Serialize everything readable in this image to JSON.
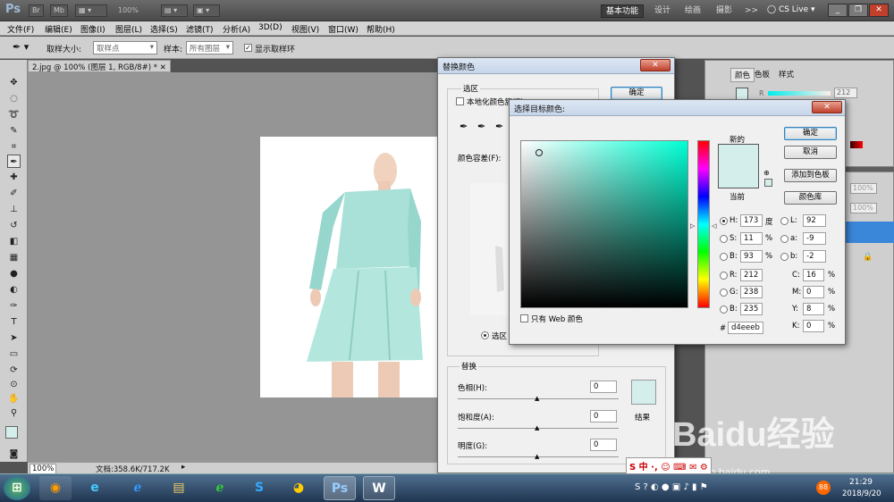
{
  "app": {
    "logo": "Ps",
    "zoom": "100%",
    "workspaces": [
      "基本功能",
      "设计",
      "绘画",
      "摄影"
    ],
    "more": ">>",
    "cslive": "CS Live"
  },
  "menu": [
    "文件(F)",
    "编辑(E)",
    "图像(I)",
    "图层(L)",
    "选择(S)",
    "滤镜(T)",
    "分析(A)",
    "3D(D)",
    "视图(V)",
    "窗口(W)",
    "帮助(H)"
  ],
  "options": {
    "sample_size_label": "取样大小:",
    "sample_size_value": "取样点",
    "sample_label": "样本:",
    "sample_value": "所有图层",
    "show_ring_label": "显示取样环"
  },
  "document": {
    "tab": "2.jpg @ 100% (图层 1, RGB/8#) *",
    "status_zoom": "100%",
    "status_doc": "文档:358.6K/717.2K"
  },
  "panels": {
    "tabs": [
      "颜色",
      "色板",
      "样式"
    ],
    "r_label": "R",
    "r_value": "212",
    "opacity1": "100%",
    "opacity2": "100%"
  },
  "replace_dialog": {
    "title": "替换颜色",
    "section_selection": "选区",
    "localized_label": "本地化颜色簇(Z)",
    "ok": "确定",
    "tolerance_label": "颜色容差(F):",
    "selection_radio": "选区",
    "section_replace": "替换",
    "hue_label": "色相(H):",
    "hue_value": "0",
    "saturation_label": "饱和度(A):",
    "saturation_value": "0",
    "lightness_label": "明度(G):",
    "lightness_value": "0",
    "result_label": "结果"
  },
  "picker": {
    "title": "选择目标颜色:",
    "new_label": "新的",
    "current_label": "当前",
    "ok": "确定",
    "cancel": "取消",
    "add_swatch": "添加到色板",
    "libraries": "颜色库",
    "web_only": "只有 Web 颜色",
    "H": "173",
    "H_unit": "度",
    "S": "11",
    "S_unit": "%",
    "B": "93",
    "B_unit": "%",
    "R": "212",
    "G": "238",
    "Bv": "235",
    "L": "92",
    "a": "-9",
    "b": "-2",
    "C": "16",
    "M": "0",
    "Y": "8",
    "K": "0",
    "pct": "%",
    "hash": "#",
    "hex": "d4eeeb",
    "new_color": "#d4eeeb",
    "hue_color": "#00ffd4"
  },
  "taskbar": {
    "time": "21:29",
    "date": "2018/9/20",
    "badge": "88"
  },
  "watermark": "Baidu经验",
  "watermark_url": "jingyan.baidu.com"
}
